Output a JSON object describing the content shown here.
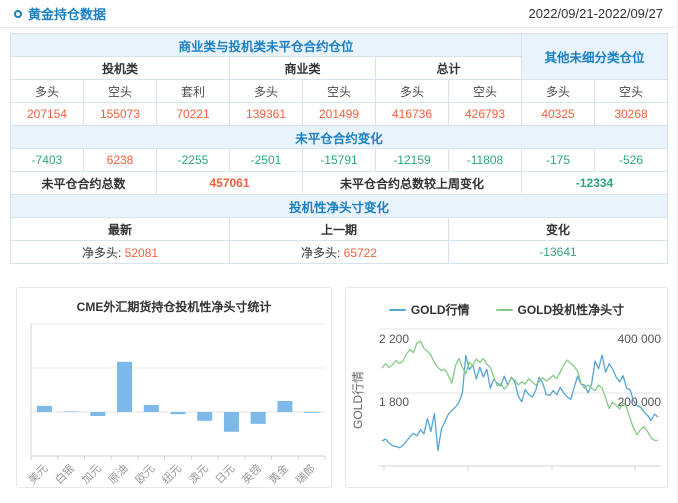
{
  "header": {
    "title": "黄金持仓数据",
    "date_range": "2022/09/21-2022/09/27"
  },
  "colors": {
    "accent_blue": "#1a80c4",
    "header_bg": "#e9f3fb",
    "positive_orange": "#f75f3b",
    "negative_green": "#2aa77e",
    "table_border": "#d7e4f0",
    "bar_fill": "#7db9e8",
    "line_blue": "#56a4d6",
    "line_green": "#86ca86"
  },
  "table": {
    "section1_title": "商业类与投机类未平仓合约仓位",
    "other_title": "其他未细分类仓位",
    "group_headers": [
      "投机类",
      "商业类",
      "总计"
    ],
    "col_headers": [
      "多头",
      "空头",
      "套利",
      "多头",
      "空头",
      "多头",
      "空头",
      "多头",
      "空头"
    ],
    "open_interest": [
      "207154",
      "155073",
      "70221",
      "139361",
      "201499",
      "416736",
      "426793",
      "40325",
      "30268"
    ],
    "change_title": "未平仓合约变化",
    "oi_change": [
      "-7403",
      "6238",
      "-2255",
      "-2501",
      "-15791",
      "-12159",
      "-11808",
      "-175",
      "-526"
    ],
    "total_label": "未平仓合约总数",
    "total_value": "457061",
    "total_change_label": "未平仓合约总数较上周变化",
    "total_change_value": "-12334",
    "net_section_title": "投机性净头寸变化",
    "net_headers": [
      "最新",
      "上一期",
      "变化"
    ],
    "net_latest_label": "净多头:",
    "net_latest_value": "52081",
    "net_prev_label": "净多头:",
    "net_prev_value": "65722",
    "net_change_value": "-13641"
  },
  "chart_data": [
    {
      "type": "bar",
      "title": "CME外汇期货持仓投机性净头寸统计",
      "categories": [
        "美元",
        "白银",
        "加元",
        "原油",
        "欧元",
        "纽元",
        "澳元",
        "日元",
        "英镑",
        "黄金",
        "瑞郎"
      ],
      "values": [
        14,
        1,
        -9,
        114,
        16,
        -5,
        -20,
        -45,
        -27,
        25,
        -2
      ],
      "ylim": [
        -100,
        200
      ],
      "gridline_step": 100,
      "y_axis_labels": "hidden",
      "bar_color": "#7db9e8"
    },
    {
      "type": "line",
      "legend": [
        "GOLD行情",
        "GOLD投机性净头寸"
      ],
      "y_left": {
        "label": "GOLD行情",
        "tick_high": "2 200",
        "tick_low": "1 800",
        "range": [
          1344,
          2200
        ]
      },
      "y_right": {
        "tick_high": "400 000",
        "tick_low": "200 000",
        "range": [
          -28000,
          400000
        ]
      },
      "grid": "horizontal",
      "x_axis_labels": "hidden",
      "series": [
        {
          "name": "GOLD行情",
          "axis": "left",
          "color": "#56a4d6",
          "values": [
            1500,
            1512,
            1488,
            1470,
            1466,
            1458,
            1472,
            1500,
            1525,
            1548,
            1532,
            1570,
            1545,
            1640,
            1560,
            1672,
            1440,
            1575,
            1620,
            1668,
            1690,
            1712,
            1740,
            1800,
            2035,
            1945,
            1975,
            1888,
            1962,
            1900,
            1948,
            1830,
            1885,
            1862,
            1845,
            1905,
            1850,
            1900,
            1868,
            1780,
            1745,
            1822,
            1790,
            1775,
            1815,
            1898,
            1862,
            1790,
            1785,
            1815,
            1790,
            1835,
            1800,
            1775,
            1760,
            1835,
            1905,
            1855,
            1850,
            1800,
            1855,
            2000,
            1952,
            2038,
            1930,
            1982,
            1950,
            1900,
            1870,
            1908,
            1830,
            1820,
            1752,
            1722,
            1712,
            1682,
            1660,
            1628,
            1668,
            1650
          ]
        },
        {
          "name": "GOLD投机性净头寸",
          "axis": "right",
          "color": "#86ca86",
          "values": [
            278000,
            292000,
            280000,
            288000,
            302000,
            292000,
            300000,
            322000,
            336000,
            326000,
            356000,
            362000,
            340000,
            330000,
            318000,
            295000,
            280000,
            270000,
            274000,
            254000,
            230000,
            285000,
            308000,
            280000,
            260000,
            296000,
            286000,
            306000,
            296000,
            308000,
            290000,
            280000,
            250000,
            222000,
            230000,
            212000,
            225000,
            248000,
            240000,
            225000,
            235000,
            228000,
            245000,
            235000,
            225000,
            235000,
            248000,
            238000,
            245000,
            255000,
            245000,
            265000,
            288000,
            303000,
            293000,
            283000,
            268000,
            230000,
            215000,
            225000,
            215000,
            208000,
            225000,
            215000,
            185000,
            152000,
            172000,
            162000,
            150000,
            170000,
            155000,
            120000,
            90000,
            70000,
            85000,
            95000,
            80000,
            60000,
            52000,
            52000
          ]
        }
      ]
    }
  ]
}
